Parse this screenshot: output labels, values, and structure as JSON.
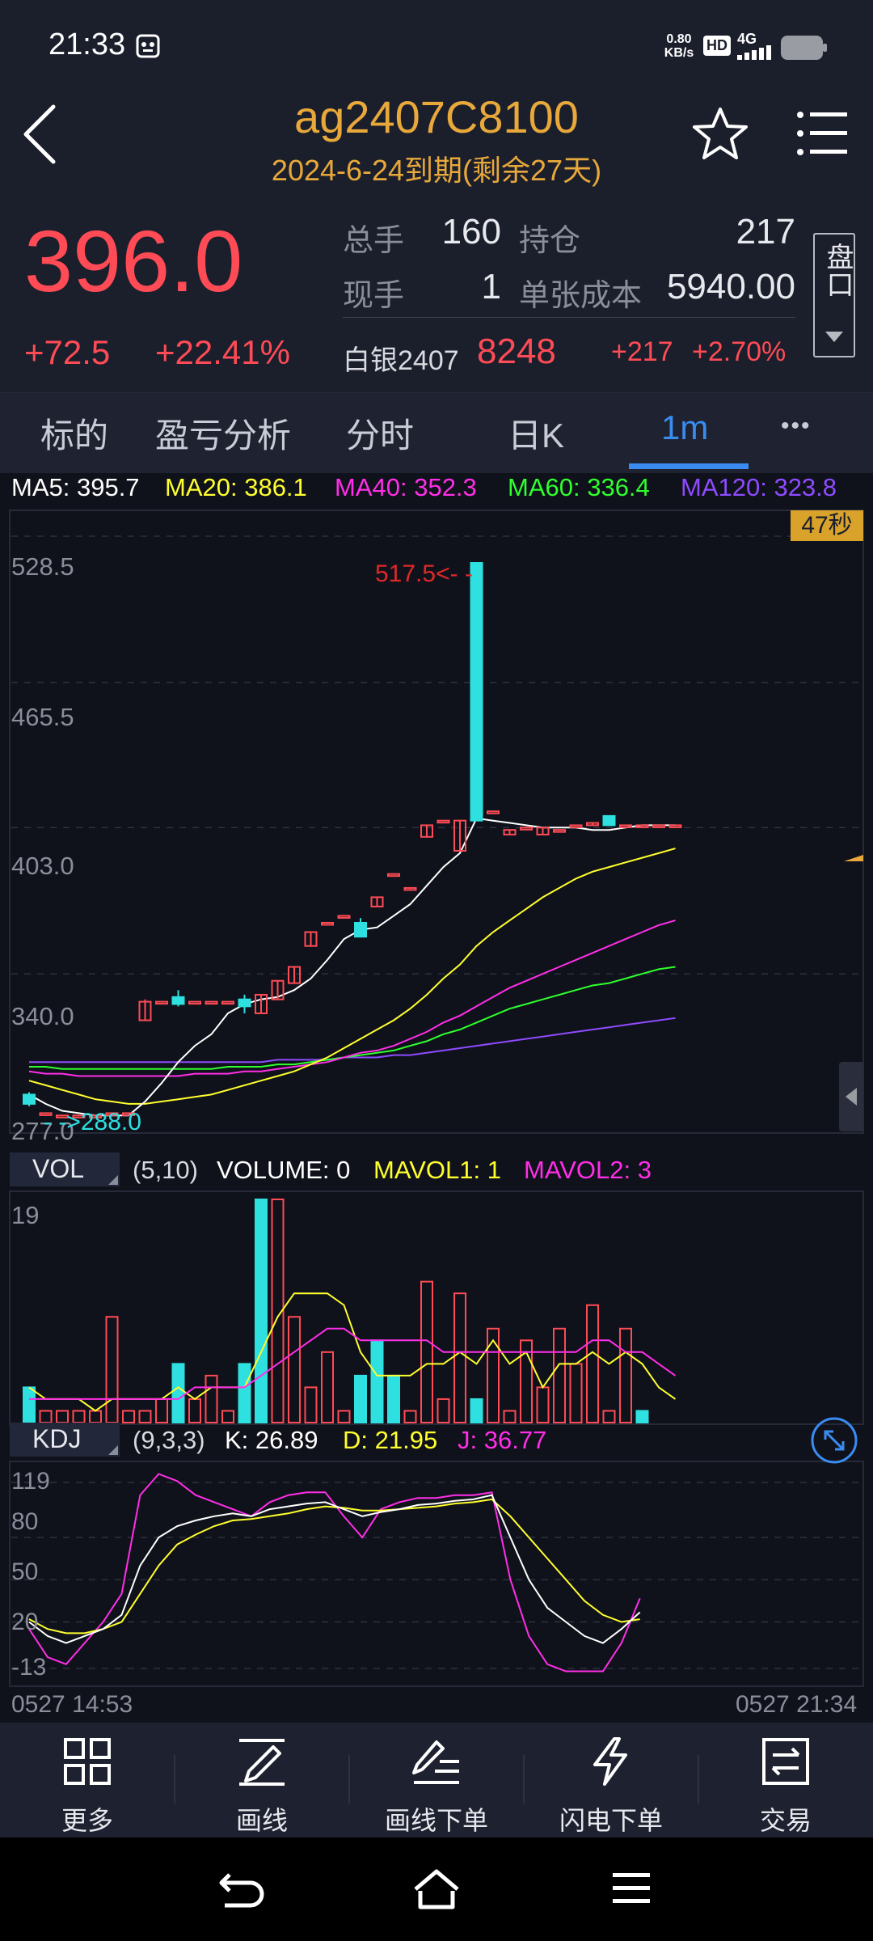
{
  "status": {
    "time": "21:33",
    "net_speed_top": "0.80",
    "net_speed_bottom": "KB/s",
    "hd": "HD",
    "signal": "4G"
  },
  "header": {
    "symbol": "ag2407C8100",
    "expiry": "2024-6-24到期(剩余27天)"
  },
  "quote": {
    "price": "396.0",
    "change": "+72.5",
    "change_pct": "+22.41%",
    "total_label": "总手",
    "total": "160",
    "oi_label": "持仓",
    "oi": "217",
    "now_label": "现手",
    "now": "1",
    "cost_label": "单张成本",
    "cost": "5940.00",
    "underlying_label": "白银2407",
    "underlying_price": "8248",
    "underlying_change": "+217",
    "underlying_pct": "+2.70%",
    "panel_btn": "盘口"
  },
  "tabs": [
    "标的",
    "盈亏分析",
    "分时",
    "日K",
    "1m",
    "•••"
  ],
  "active_tab": 4,
  "ma": {
    "ma5": "MA5: 395.7",
    "ma20": "MA20: 386.1",
    "ma40": "MA40: 352.3",
    "ma60": "MA60: 336.4",
    "ma120": "MA120: 323.8"
  },
  "countdown": "47秒",
  "price_axis": [
    "528.5",
    "465.5",
    "403.0",
    "340.0",
    "277.0"
  ],
  "high_mark": "517.5<- -",
  "low_mark": "- ->288.0",
  "vol": {
    "tab": "VOL",
    "params": "(5,10)",
    "volume": "VOLUME: 0",
    "mavol1": "MAVOL1: 1",
    "mavol2": "MAVOL2: 3",
    "axis_top": "19"
  },
  "kdj": {
    "tab": "KDJ",
    "params": "(9,3,3)",
    "k": "K: 26.89",
    "d": "D: 21.95",
    "j": "J: 36.77",
    "axis": [
      "119",
      "80",
      "50",
      "20",
      "-13"
    ]
  },
  "time_axis": {
    "start": "0527 14:53",
    "end": "0527 21:34"
  },
  "toolbar": {
    "more": "更多",
    "draw": "画线",
    "draw_order": "画线下单",
    "flash_order": "闪电下单",
    "trade": "交易"
  },
  "colors": {
    "up": "#ff4b55",
    "down": "#2ee0e0",
    "gold": "#e8a83a",
    "ma5": "#ffffff",
    "ma20": "#ffff2e",
    "ma40": "#ff2ee8",
    "ma60": "#2eff2e",
    "ma120": "#8e4bff"
  },
  "chart_data": {
    "type": "candlestick",
    "price_range": [
      277.0,
      528.5
    ],
    "candles": [
      {
        "o": 288,
        "c": 284,
        "h": 289,
        "l": 283
      },
      {
        "o": 280,
        "c": 280,
        "h": 280,
        "l": 280
      },
      {
        "o": 279,
        "c": 279,
        "h": 279,
        "l": 279
      },
      {
        "o": 279,
        "c": 279,
        "h": 279,
        "l": 279
      },
      {
        "o": 279,
        "c": 279,
        "h": 279,
        "l": 279
      },
      {
        "o": 280,
        "c": 280,
        "h": 280,
        "l": 280
      },
      {
        "o": 280,
        "c": 280,
        "h": 280,
        "l": 280
      },
      {
        "o": 320,
        "c": 328,
        "h": 329,
        "l": 320
      },
      {
        "o": 328,
        "c": 328,
        "h": 328,
        "l": 328
      },
      {
        "o": 330,
        "c": 327,
        "h": 333,
        "l": 326
      },
      {
        "o": 328,
        "c": 328,
        "h": 328,
        "l": 328
      },
      {
        "o": 328,
        "c": 328,
        "h": 328,
        "l": 328
      },
      {
        "o": 328,
        "c": 328,
        "h": 328,
        "l": 328
      },
      {
        "o": 329,
        "c": 326,
        "h": 331,
        "l": 323
      },
      {
        "o": 323,
        "c": 331,
        "h": 331,
        "l": 323
      },
      {
        "o": 329,
        "c": 337,
        "h": 337,
        "l": 329
      },
      {
        "o": 336,
        "c": 343,
        "h": 343,
        "l": 336
      },
      {
        "o": 352,
        "c": 358,
        "h": 358,
        "l": 352
      },
      {
        "o": 362,
        "c": 362,
        "h": 362,
        "l": 362
      },
      {
        "o": 365,
        "c": 365,
        "h": 365,
        "l": 365
      },
      {
        "o": 362,
        "c": 356,
        "h": 364,
        "l": 356
      },
      {
        "o": 369,
        "c": 373,
        "h": 373,
        "l": 369
      },
      {
        "o": 383,
        "c": 383,
        "h": 383,
        "l": 383
      },
      {
        "o": 377,
        "c": 377,
        "h": 377,
        "l": 377
      },
      {
        "o": 399,
        "c": 404,
        "h": 404,
        "l": 399
      },
      {
        "o": 406,
        "c": 406,
        "h": 406,
        "l": 406
      },
      {
        "o": 393,
        "c": 406,
        "h": 406,
        "l": 393
      },
      {
        "o": 517,
        "c": 406,
        "h": 517,
        "l": 406
      },
      {
        "o": 410,
        "c": 410,
        "h": 410,
        "l": 410
      },
      {
        "o": 400,
        "c": 402,
        "h": 402,
        "l": 400
      },
      {
        "o": 403,
        "c": 403,
        "h": 403,
        "l": 403
      },
      {
        "o": 400,
        "c": 403,
        "h": 403,
        "l": 400
      },
      {
        "o": 402,
        "c": 402,
        "h": 402,
        "l": 402
      },
      {
        "o": 404,
        "c": 404,
        "h": 404,
        "l": 404
      },
      {
        "o": 404,
        "c": 405,
        "h": 405,
        "l": 404
      },
      {
        "o": 408,
        "c": 404,
        "h": 408,
        "l": 404
      },
      {
        "o": 404,
        "c": 404,
        "h": 404,
        "l": 404
      },
      {
        "o": 404,
        "c": 404,
        "h": 404,
        "l": 404
      },
      {
        "o": 404,
        "c": 404,
        "h": 404,
        "l": 404
      },
      {
        "o": 404,
        "c": 404,
        "h": 404,
        "l": 404
      }
    ],
    "ma5": [
      288,
      284,
      281,
      280,
      279,
      279,
      279,
      285,
      293,
      302,
      309,
      314,
      323,
      327,
      329,
      330,
      333,
      338,
      346,
      355,
      359,
      360,
      365,
      370,
      378,
      386,
      392,
      407,
      406,
      405,
      404,
      403,
      403,
      403,
      402,
      402,
      403,
      404,
      404,
      404
    ],
    "ma20": [
      294,
      292,
      290,
      288,
      286,
      285,
      284,
      284,
      285,
      286,
      287,
      288,
      290,
      292,
      294,
      296,
      298,
      301,
      304,
      308,
      312,
      316,
      320,
      325,
      331,
      338,
      344,
      352,
      358,
      363,
      368,
      373,
      377,
      381,
      384,
      386,
      388,
      390,
      392,
      394
    ],
    "ma40": [
      298,
      297,
      297,
      296,
      296,
      296,
      296,
      296,
      296,
      296,
      297,
      297,
      297,
      298,
      298,
      299,
      300,
      301,
      302,
      304,
      306,
      307,
      309,
      312,
      315,
      319,
      322,
      326,
      330,
      334,
      337,
      340,
      343,
      346,
      349,
      352,
      355,
      358,
      361,
      363
    ],
    "ma60": [
      300,
      300,
      299,
      299,
      299,
      299,
      299,
      299,
      299,
      299,
      299,
      299,
      300,
      300,
      300,
      301,
      301,
      302,
      303,
      304,
      305,
      306,
      307,
      309,
      311,
      314,
      316,
      319,
      322,
      325,
      327,
      329,
      331,
      333,
      335,
      336,
      338,
      340,
      342,
      343
    ],
    "ma120": [
      302,
      302,
      302,
      302,
      302,
      302,
      302,
      302,
      302,
      302,
      302,
      302,
      302,
      302,
      302,
      303,
      303,
      303,
      303,
      304,
      304,
      304,
      305,
      305,
      306,
      307,
      308,
      309,
      310,
      311,
      312,
      313,
      314,
      315,
      316,
      317,
      318,
      319,
      320,
      321
    ],
    "volume_range": [
      0,
      19
    ],
    "volume": [
      3,
      1,
      1,
      1,
      1,
      9,
      1,
      1,
      2,
      5,
      2,
      4,
      1,
      5,
      19,
      19,
      9,
      3,
      6,
      1,
      4,
      7,
      4,
      1,
      12,
      2,
      11,
      2,
      8,
      1,
      7,
      3,
      8,
      5,
      10,
      1,
      8,
      1,
      0,
      0
    ],
    "volume_up": [
      false,
      true,
      true,
      true,
      true,
      true,
      true,
      true,
      true,
      false,
      true,
      true,
      true,
      false,
      false,
      true,
      true,
      true,
      true,
      true,
      false,
      false,
      false,
      true,
      true,
      true,
      true,
      false,
      true,
      true,
      true,
      true,
      true,
      true,
      true,
      true,
      true,
      false,
      false,
      false
    ],
    "mavol1": [
      3,
      2,
      2,
      2,
      1,
      2,
      2,
      2,
      2,
      3,
      2,
      3,
      3,
      3,
      6,
      9,
      11,
      11,
      11,
      10,
      6,
      4,
      4,
      4,
      5,
      5,
      6,
      5,
      7,
      5,
      6,
      3,
      5,
      5,
      6,
      5,
      6,
      5,
      3,
      2
    ],
    "mavol2": [
      2,
      2,
      2,
      2,
      2,
      2,
      2,
      2,
      2,
      2,
      3,
      3,
      3,
      3,
      4,
      5,
      6,
      7,
      8,
      8,
      7,
      7,
      7,
      7,
      7,
      6,
      6,
      6,
      6,
      6,
      6,
      6,
      6,
      6,
      7,
      7,
      6,
      6,
      5,
      4
    ],
    "kdj_range": [
      -13,
      119
    ],
    "k": [
      20,
      10,
      5,
      10,
      15,
      25,
      60,
      80,
      88,
      92,
      95,
      97,
      95,
      100,
      102,
      104,
      105,
      100,
      95,
      98,
      100,
      103,
      104,
      106,
      107,
      110,
      80,
      50,
      30,
      20,
      10,
      5,
      15,
      26.89
    ],
    "d": [
      22,
      15,
      12,
      12,
      15,
      20,
      40,
      60,
      75,
      82,
      88,
      92,
      93,
      95,
      97,
      100,
      102,
      101,
      99,
      99,
      100,
      101,
      102,
      104,
      105,
      107,
      95,
      80,
      65,
      50,
      35,
      25,
      20,
      21.95
    ],
    "j": [
      15,
      -5,
      -10,
      5,
      20,
      40,
      110,
      125,
      120,
      110,
      105,
      100,
      95,
      105,
      110,
      112,
      112,
      95,
      80,
      100,
      105,
      108,
      108,
      110,
      110,
      112,
      50,
      10,
      -10,
      -15,
      -15,
      -15,
      5,
      36.77
    ]
  }
}
